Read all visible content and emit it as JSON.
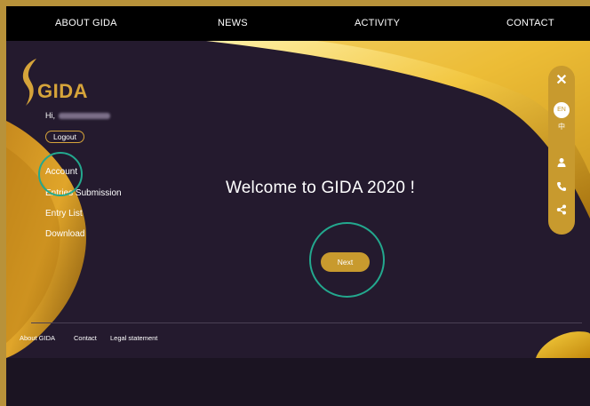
{
  "topnav": {
    "about": "ABOUT GIDA",
    "news": "NEWS",
    "activity": "ACTIVITY",
    "contact": "CONTACT"
  },
  "logo_text": "GIDA",
  "user": {
    "greeting": "Hi,",
    "logout": "Logout"
  },
  "menu": {
    "account": "Account",
    "entries": "Entries Submission",
    "entry_list": "Entry List",
    "download": "Download"
  },
  "main": {
    "welcome": "Welcome to GIDA 2020 !",
    "next": "Next"
  },
  "rail": {
    "close": "✕",
    "en": "EN",
    "zh": "中",
    "icons": [
      "user-icon",
      "phone-icon",
      "share-icon"
    ]
  },
  "footer": {
    "about": "About GIDA",
    "contact": "Contact",
    "legal": "Legal statement"
  },
  "colors": {
    "gold": "#c89a2e",
    "highlight_ring": "#23a88e",
    "background": "#241a2e"
  }
}
